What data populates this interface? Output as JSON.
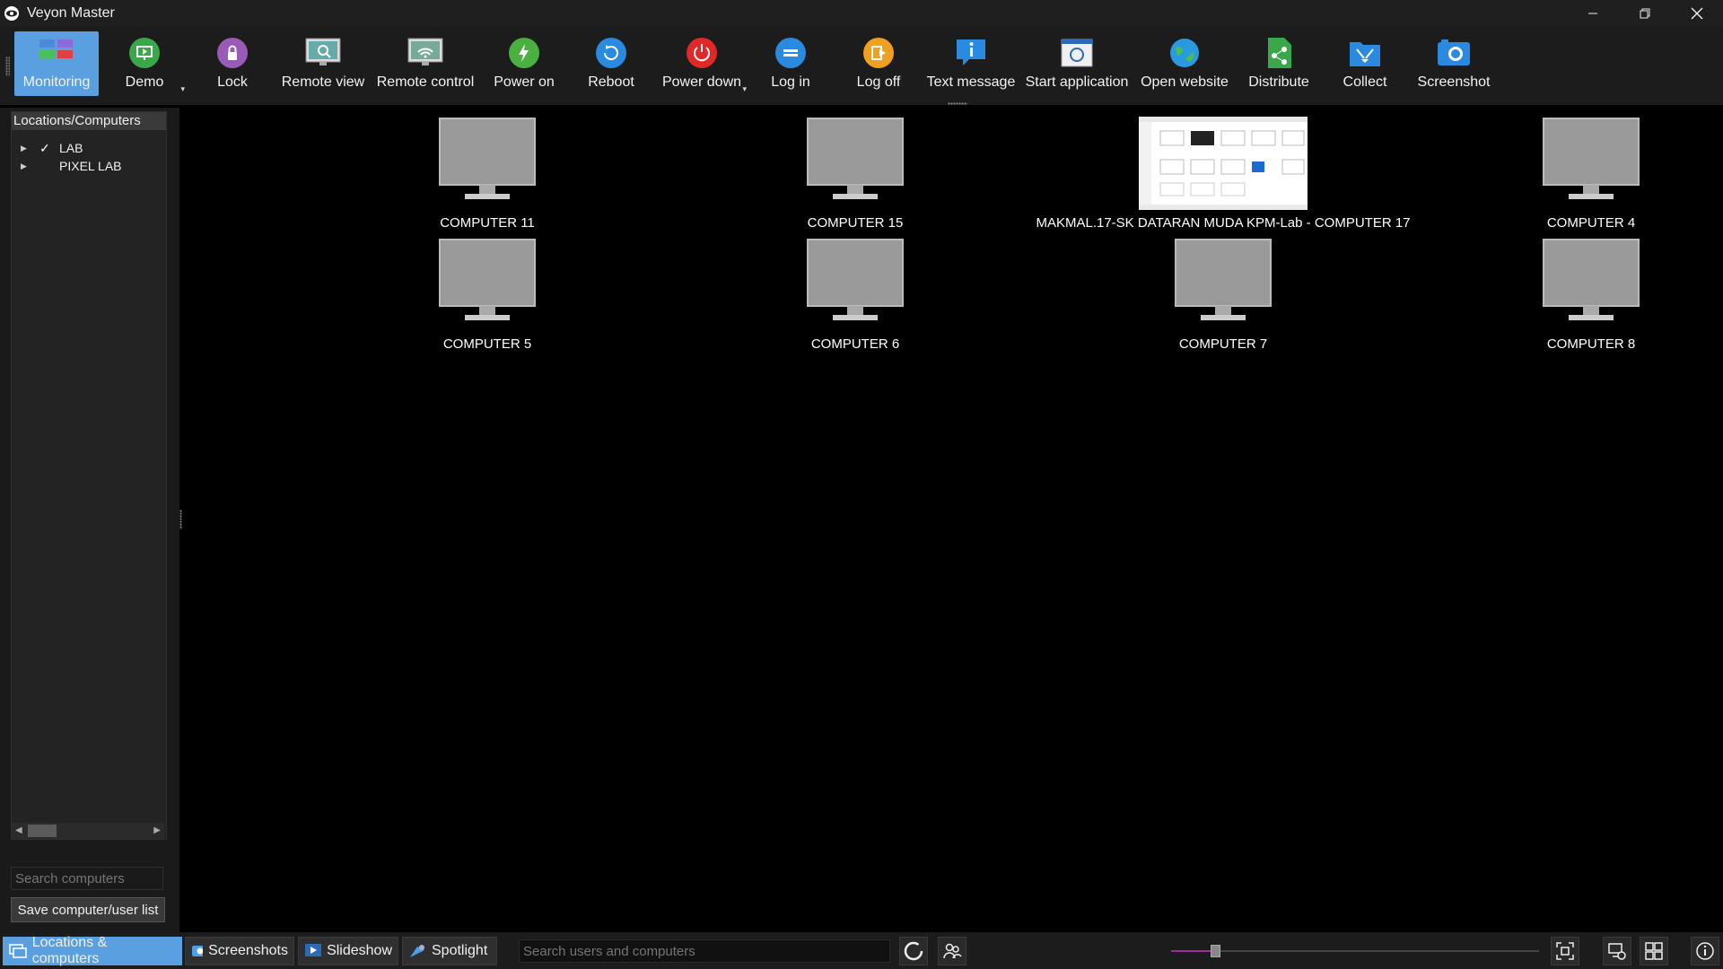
{
  "window": {
    "title": "Veyon Master"
  },
  "toolbar": {
    "buttons": [
      {
        "label": "Monitoring",
        "icon": "monitoring-icon",
        "active": true
      },
      {
        "label": "Demo",
        "icon": "demo-icon",
        "dropdown": true
      },
      {
        "label": "Lock",
        "icon": "lock-icon"
      },
      {
        "label": "Remote view",
        "icon": "remote-view-icon"
      },
      {
        "label": "Remote control",
        "icon": "remote-control-icon"
      },
      {
        "label": "Power on",
        "icon": "power-on-icon"
      },
      {
        "label": "Reboot",
        "icon": "reboot-icon"
      },
      {
        "label": "Power down",
        "icon": "power-down-icon",
        "dropdown": true
      },
      {
        "label": "Log in",
        "icon": "log-in-icon"
      },
      {
        "label": "Log off",
        "icon": "log-off-icon"
      },
      {
        "label": "Text message",
        "icon": "text-message-icon"
      },
      {
        "label": "Start application",
        "icon": "start-application-icon"
      },
      {
        "label": "Open website",
        "icon": "open-website-icon"
      },
      {
        "label": "Distribute",
        "icon": "distribute-icon"
      },
      {
        "label": "Collect",
        "icon": "collect-icon"
      },
      {
        "label": "Screenshot",
        "icon": "screenshot-icon"
      }
    ]
  },
  "sidebar": {
    "header": "Locations/Computers",
    "items": [
      {
        "label": "LAB",
        "checked": true
      },
      {
        "label": "PIXEL LAB",
        "checked": false
      }
    ],
    "search_placeholder": "Search computers",
    "save_button": "Save computer/user list"
  },
  "computers": [
    {
      "name": "COMPUTER 11",
      "has_screen": false
    },
    {
      "name": "COMPUTER 15",
      "has_screen": false
    },
    {
      "name": "MAKMAL.17-SK DATARAN MUDA KPM-Lab - COMPUTER 17",
      "has_screen": true
    },
    {
      "name": "COMPUTER 4",
      "has_screen": false
    },
    {
      "name": "COMPUTER 5",
      "has_screen": false
    },
    {
      "name": "COMPUTER 6",
      "has_screen": false
    },
    {
      "name": "COMPUTER 7",
      "has_screen": false
    },
    {
      "name": "COMPUTER 8",
      "has_screen": false
    }
  ],
  "bottombar": {
    "tabs": [
      {
        "label": "Locations & computers",
        "active": true
      },
      {
        "label": "Screenshots",
        "active": false
      },
      {
        "label": "Slideshow",
        "active": false
      },
      {
        "label": "Spotlight",
        "active": false
      }
    ],
    "search_placeholder": "Search users and computers",
    "zoom_level": 0.12
  },
  "colors": {
    "accent": "#5aa0e0",
    "zoom": "#a028a0"
  }
}
